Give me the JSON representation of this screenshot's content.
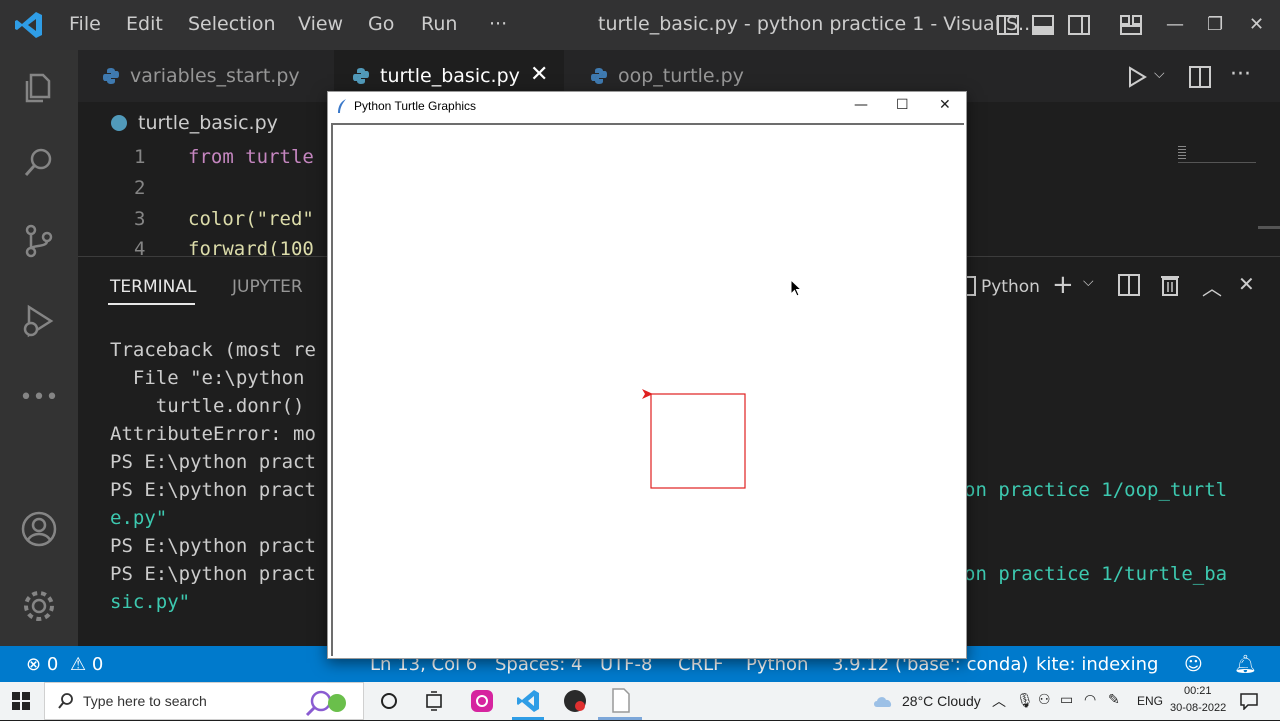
{
  "titlebar": {
    "menu": [
      "File",
      "Edit",
      "Selection",
      "View",
      "Go",
      "Run",
      "···"
    ],
    "title": "turtle_basic.py - python practice 1 - Visual S..."
  },
  "tabs": [
    {
      "label": "variables_start.py"
    },
    {
      "label": "turtle_basic.py"
    },
    {
      "label": "oop_turtle.py"
    }
  ],
  "breadcrumb": "turtle_basic.py",
  "code_lines": [
    {
      "num": "1",
      "text": "from turtle"
    },
    {
      "num": "2",
      "text": ""
    },
    {
      "num": "3",
      "text": "color(\"red\""
    },
    {
      "num": "4",
      "text": "forward(100"
    }
  ],
  "panel": {
    "tabs": [
      "TERMINAL",
      "JUPYTER"
    ],
    "shell": "Python",
    "lines": [
      "Traceback (most re",
      "  File \"e:\\python",
      "    turtle.donr()",
      "AttributeError: mo",
      "PS E:\\python pract",
      "PS E:\\python pract",
      "e.py\"",
      "PS E:\\python pract",
      "PS E:\\python pract",
      "sic.py\""
    ],
    "right_lines": [
      "on practice 1/oop_turtl",
      "on practice 1/turtle_ba"
    ]
  },
  "turtle_window": {
    "title": "Python Turtle Graphics",
    "pen_color": "#e02020"
  },
  "statusbar": {
    "errors": "0",
    "warnings": "0",
    "position": "Ln 13, Col 6",
    "spaces": "Spaces: 4",
    "encoding": "UTF-8",
    "eol": "CRLF",
    "language": "Python",
    "interpreter": "3.9.12 ('base': conda)",
    "kite": "kite: indexing"
  },
  "taskbar": {
    "search_placeholder": "Type here to search",
    "weather": "28°C  Cloudy",
    "lang": "ENG",
    "time": "00:21",
    "date": "30-08-2022"
  },
  "colors": {
    "accent": "#007acc",
    "titlebar": "#323233",
    "editor_bg": "#1e1e1e",
    "terminal_cyan": "#3dc9b0"
  }
}
